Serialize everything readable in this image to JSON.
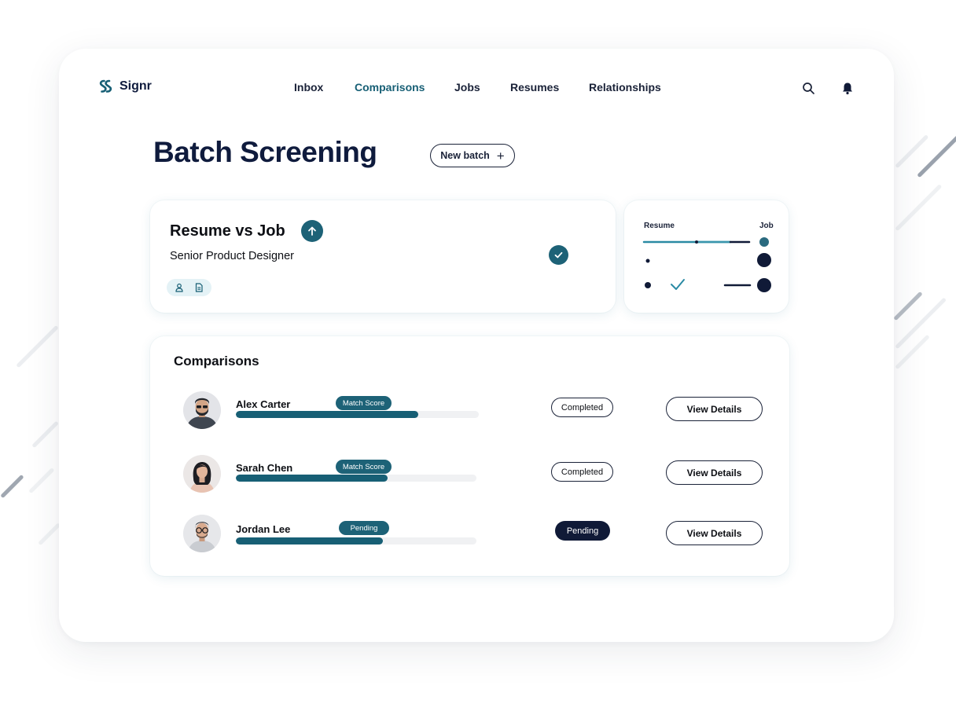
{
  "brand": {
    "name": "Signr",
    "accent": "#1d6277",
    "navy": "#0f1b3d"
  },
  "nav": {
    "items": [
      {
        "label": "Inbox",
        "active": false
      },
      {
        "label": "Comparisons",
        "active": true
      },
      {
        "label": "Jobs",
        "active": false
      },
      {
        "label": "Resumes",
        "active": false
      },
      {
        "label": "Relationships",
        "active": false
      }
    ],
    "icons": [
      "search-icon",
      "bell-icon"
    ]
  },
  "page": {
    "title": "Batch Screening",
    "new_batch_label": "New batch"
  },
  "summary_card": {
    "title": "Resume vs Job",
    "subtitle": "Senior Product Designer",
    "chip_icons": [
      "user-icon",
      "document-icon"
    ],
    "status_icon": "check-circle-icon"
  },
  "mini_card": {
    "left_label": "Resume",
    "right_label": "Job"
  },
  "comparisons": {
    "title": "Comparisons",
    "rows": [
      {
        "name": "Alex Carter",
        "tag": "Match Score",
        "progress": 0.75,
        "status": "Completed",
        "status_style": "outline",
        "action": "View Details"
      },
      {
        "name": "Sarah Chen",
        "tag": "Match Score",
        "progress": 0.63,
        "status": "Completed",
        "status_style": "outline",
        "action": "View Details"
      },
      {
        "name": "Jordan Lee",
        "tag": "Pending",
        "progress": 0.61,
        "status": "Pending",
        "status_style": "dark",
        "action": "View Details"
      }
    ]
  }
}
